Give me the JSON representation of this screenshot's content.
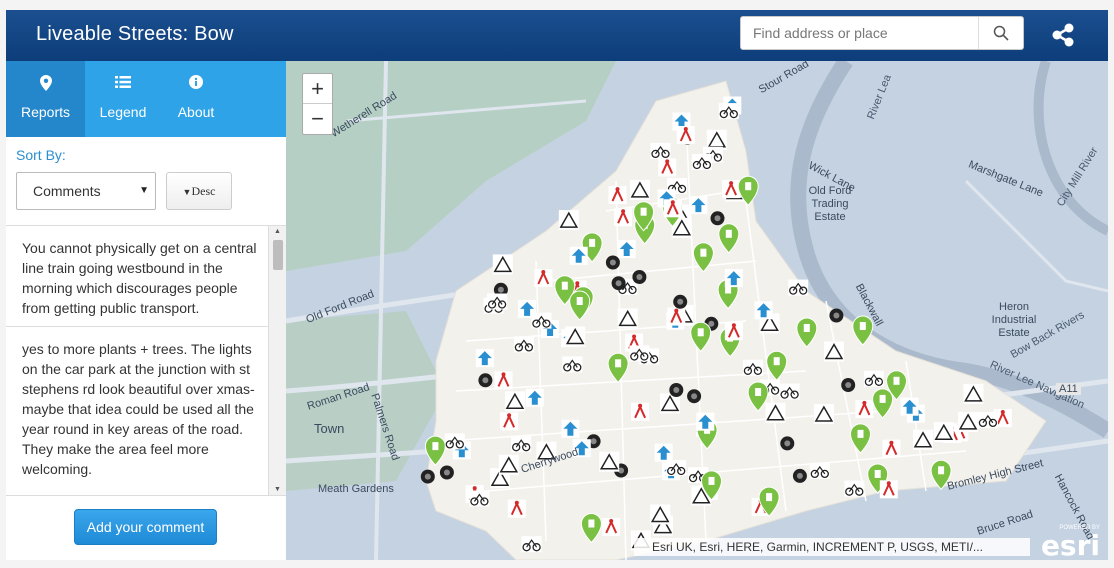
{
  "app": {
    "title": "Liveable Streets: Bow"
  },
  "search": {
    "placeholder": "Find address or place"
  },
  "tabs": [
    {
      "label": "Reports",
      "icon": "map-pin-icon",
      "active": true
    },
    {
      "label": "Legend",
      "icon": "list-icon",
      "active": false
    },
    {
      "label": "About",
      "icon": "info-icon",
      "active": false
    }
  ],
  "sort": {
    "label": "Sort By:",
    "selected": "Comments",
    "order_label": "Desc"
  },
  "comments": [
    {
      "text": "You cannot physically get on a central line train going westbound in the morning which discourages people from getting public transport."
    },
    {
      "text": "yes to more plants + trees. The lights on the car park at the junction with st stephens rd look beautiful over xmas- maybe that idea could be used all the year round in key areas of the road. They make the area feel more welcoming."
    }
  ],
  "add_comment_label": "Add your comment",
  "map": {
    "zoom_in": "+",
    "zoom_out": "−",
    "attribution": "Esri UK, Esri, HERE, Garmin, INCREMENT P, USGS, METI/...",
    "esri_powered": "POWERED BY",
    "esri_logo": "esri",
    "labels": {
      "wetherell_road": "Wetherell Road",
      "old_ford_road": "Old Ford Road",
      "roman_road": "Roman Road",
      "palmers_road": "Palmers Road",
      "town": "Town",
      "meath_gardens": "Meath Gardens",
      "river_lea": "River Lea",
      "stour_road": "Stour Road",
      "city_mill_river": "City Mill River",
      "marshgate_lane": "Marshgate Lane",
      "wick_lane": "Wick Lane",
      "old_ford_trading_estate": "Old Ford Trading Estate",
      "heron_industrial_estate": "Heron Industrial Estate",
      "bow_back_rivers": "Bow Back Rivers",
      "river_lee_navigation": "River Lee Navigation",
      "a11": "A11",
      "bromley_high_street": "Bromley High Street",
      "bruce_road": "Bruce Road",
      "hancock_road": "Hancock Road",
      "cherrywood": "Cherrywood",
      "blackwall": "Blackwall"
    }
  },
  "colors": {
    "header": "#0d3d7a",
    "tab_bar": "#2ea3e8",
    "tab_active": "#2487cb",
    "button": "#2a8fd0",
    "marker_green": "#7ac143",
    "marker_blue": "#2a8fd0"
  }
}
